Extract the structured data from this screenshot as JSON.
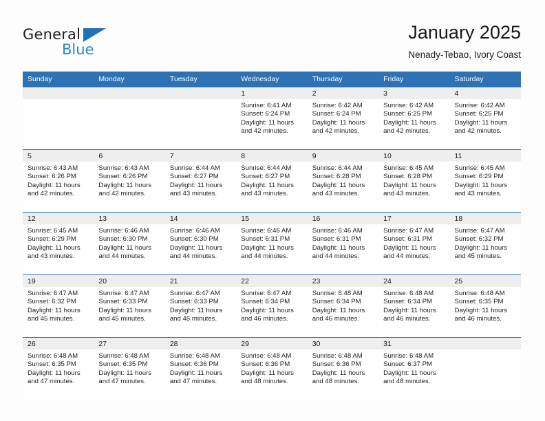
{
  "brand": {
    "name_part1": "General",
    "name_part2": "Blue",
    "triangle_color": "#1f72b8",
    "blue_text_color": "#2586d6"
  },
  "header": {
    "title": "January 2025",
    "subtitle": "Nenady-Tebao, Ivory Coast"
  },
  "theme": {
    "header_blue": "#2e72b3",
    "daynum_band": "#eeeeee",
    "page_background": "#fdfdfd"
  },
  "weekday_headers": [
    "Sunday",
    "Monday",
    "Tuesday",
    "Wednesday",
    "Thursday",
    "Friday",
    "Saturday"
  ],
  "labels": {
    "sunrise_prefix": "Sunrise:",
    "sunset_prefix": "Sunset:",
    "daylight_prefix": "Daylight:"
  },
  "weeks": [
    [
      {
        "day": "",
        "empty": true
      },
      {
        "day": "",
        "empty": true
      },
      {
        "day": "",
        "empty": true
      },
      {
        "day": "1",
        "sunrise": "Sunrise: 6:41 AM",
        "sunset": "Sunset: 6:24 PM",
        "daylight": "Daylight: 11 hours and 42 minutes."
      },
      {
        "day": "2",
        "sunrise": "Sunrise: 6:42 AM",
        "sunset": "Sunset: 6:24 PM",
        "daylight": "Daylight: 11 hours and 42 minutes."
      },
      {
        "day": "3",
        "sunrise": "Sunrise: 6:42 AM",
        "sunset": "Sunset: 6:25 PM",
        "daylight": "Daylight: 11 hours and 42 minutes."
      },
      {
        "day": "4",
        "sunrise": "Sunrise: 6:42 AM",
        "sunset": "Sunset: 6:25 PM",
        "daylight": "Daylight: 11 hours and 42 minutes."
      }
    ],
    [
      {
        "day": "5",
        "sunrise": "Sunrise: 6:43 AM",
        "sunset": "Sunset: 6:26 PM",
        "daylight": "Daylight: 11 hours and 42 minutes."
      },
      {
        "day": "6",
        "sunrise": "Sunrise: 6:43 AM",
        "sunset": "Sunset: 6:26 PM",
        "daylight": "Daylight: 11 hours and 42 minutes."
      },
      {
        "day": "7",
        "sunrise": "Sunrise: 6:44 AM",
        "sunset": "Sunset: 6:27 PM",
        "daylight": "Daylight: 11 hours and 43 minutes."
      },
      {
        "day": "8",
        "sunrise": "Sunrise: 6:44 AM",
        "sunset": "Sunset: 6:27 PM",
        "daylight": "Daylight: 11 hours and 43 minutes."
      },
      {
        "day": "9",
        "sunrise": "Sunrise: 6:44 AM",
        "sunset": "Sunset: 6:28 PM",
        "daylight": "Daylight: 11 hours and 43 minutes."
      },
      {
        "day": "10",
        "sunrise": "Sunrise: 6:45 AM",
        "sunset": "Sunset: 6:28 PM",
        "daylight": "Daylight: 11 hours and 43 minutes."
      },
      {
        "day": "11",
        "sunrise": "Sunrise: 6:45 AM",
        "sunset": "Sunset: 6:29 PM",
        "daylight": "Daylight: 11 hours and 43 minutes."
      }
    ],
    [
      {
        "day": "12",
        "sunrise": "Sunrise: 6:45 AM",
        "sunset": "Sunset: 6:29 PM",
        "daylight": "Daylight: 11 hours and 43 minutes."
      },
      {
        "day": "13",
        "sunrise": "Sunrise: 6:46 AM",
        "sunset": "Sunset: 6:30 PM",
        "daylight": "Daylight: 11 hours and 44 minutes."
      },
      {
        "day": "14",
        "sunrise": "Sunrise: 6:46 AM",
        "sunset": "Sunset: 6:30 PM",
        "daylight": "Daylight: 11 hours and 44 minutes."
      },
      {
        "day": "15",
        "sunrise": "Sunrise: 6:46 AM",
        "sunset": "Sunset: 6:31 PM",
        "daylight": "Daylight: 11 hours and 44 minutes."
      },
      {
        "day": "16",
        "sunrise": "Sunrise: 6:46 AM",
        "sunset": "Sunset: 6:31 PM",
        "daylight": "Daylight: 11 hours and 44 minutes."
      },
      {
        "day": "17",
        "sunrise": "Sunrise: 6:47 AM",
        "sunset": "Sunset: 6:31 PM",
        "daylight": "Daylight: 11 hours and 44 minutes."
      },
      {
        "day": "18",
        "sunrise": "Sunrise: 6:47 AM",
        "sunset": "Sunset: 6:32 PM",
        "daylight": "Daylight: 11 hours and 45 minutes."
      }
    ],
    [
      {
        "day": "19",
        "sunrise": "Sunrise: 6:47 AM",
        "sunset": "Sunset: 6:32 PM",
        "daylight": "Daylight: 11 hours and 45 minutes."
      },
      {
        "day": "20",
        "sunrise": "Sunrise: 6:47 AM",
        "sunset": "Sunset: 6:33 PM",
        "daylight": "Daylight: 11 hours and 45 minutes."
      },
      {
        "day": "21",
        "sunrise": "Sunrise: 6:47 AM",
        "sunset": "Sunset: 6:33 PM",
        "daylight": "Daylight: 11 hours and 45 minutes."
      },
      {
        "day": "22",
        "sunrise": "Sunrise: 6:47 AM",
        "sunset": "Sunset: 6:34 PM",
        "daylight": "Daylight: 11 hours and 46 minutes."
      },
      {
        "day": "23",
        "sunrise": "Sunrise: 6:48 AM",
        "sunset": "Sunset: 6:34 PM",
        "daylight": "Daylight: 11 hours and 46 minutes."
      },
      {
        "day": "24",
        "sunrise": "Sunrise: 6:48 AM",
        "sunset": "Sunset: 6:34 PM",
        "daylight": "Daylight: 11 hours and 46 minutes."
      },
      {
        "day": "25",
        "sunrise": "Sunrise: 6:48 AM",
        "sunset": "Sunset: 6:35 PM",
        "daylight": "Daylight: 11 hours and 46 minutes."
      }
    ],
    [
      {
        "day": "26",
        "sunrise": "Sunrise: 6:48 AM",
        "sunset": "Sunset: 6:35 PM",
        "daylight": "Daylight: 11 hours and 47 minutes."
      },
      {
        "day": "27",
        "sunrise": "Sunrise: 6:48 AM",
        "sunset": "Sunset: 6:35 PM",
        "daylight": "Daylight: 11 hours and 47 minutes."
      },
      {
        "day": "28",
        "sunrise": "Sunrise: 6:48 AM",
        "sunset": "Sunset: 6:36 PM",
        "daylight": "Daylight: 11 hours and 47 minutes."
      },
      {
        "day": "29",
        "sunrise": "Sunrise: 6:48 AM",
        "sunset": "Sunset: 6:36 PM",
        "daylight": "Daylight: 11 hours and 48 minutes."
      },
      {
        "day": "30",
        "sunrise": "Sunrise: 6:48 AM",
        "sunset": "Sunset: 6:36 PM",
        "daylight": "Daylight: 11 hours and 48 minutes."
      },
      {
        "day": "31",
        "sunrise": "Sunrise: 6:48 AM",
        "sunset": "Sunset: 6:37 PM",
        "daylight": "Daylight: 11 hours and 48 minutes."
      },
      {
        "day": "",
        "empty": true
      }
    ]
  ]
}
